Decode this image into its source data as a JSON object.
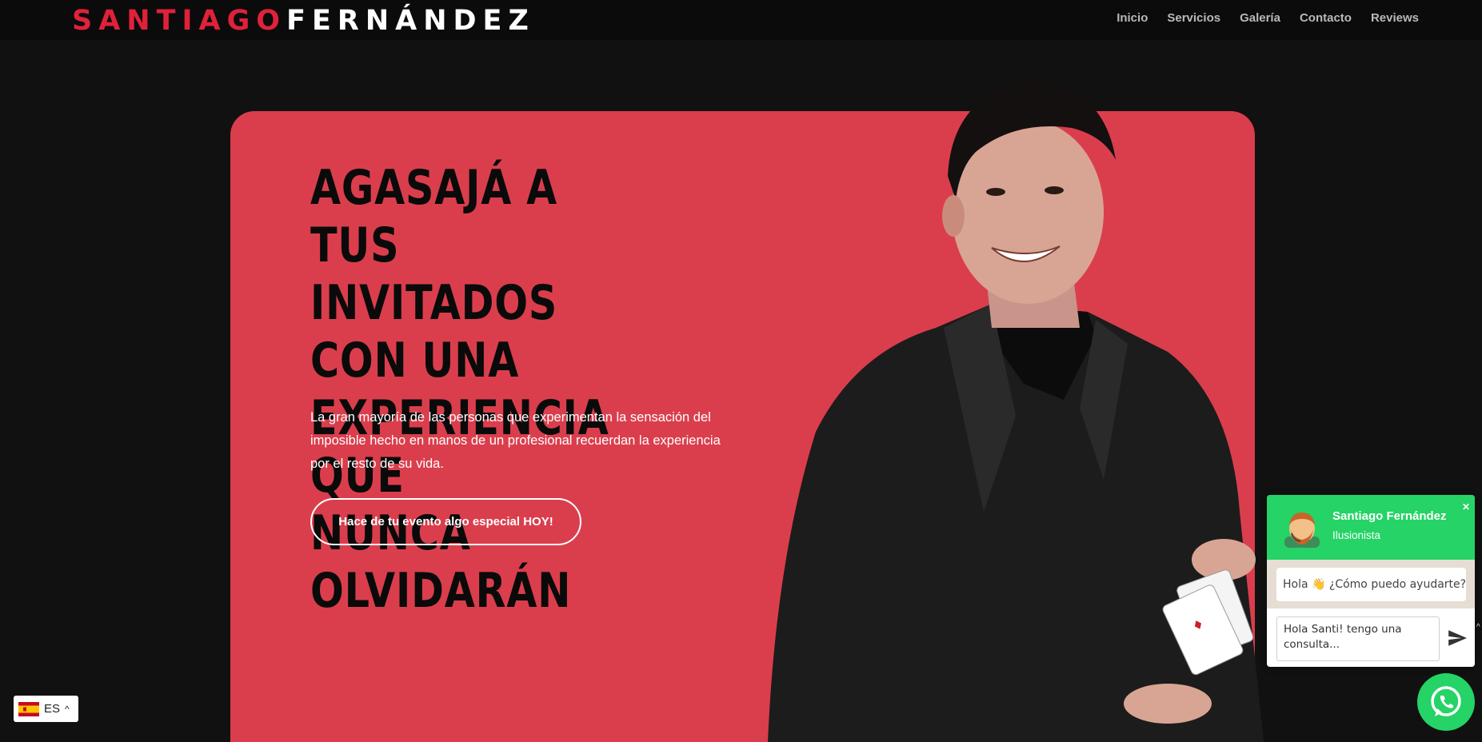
{
  "brand": {
    "first": "SANTIAGO",
    "last": "FERNÁNDEZ",
    "accent_color": "#e0213a"
  },
  "nav": {
    "items": [
      {
        "label": "Inicio"
      },
      {
        "label": "Servicios"
      },
      {
        "label": "Galería"
      },
      {
        "label": "Contacto"
      },
      {
        "label": "Reviews"
      }
    ]
  },
  "hero": {
    "background": "#da3e4c",
    "headline_lines": [
      "AGASAJÁ A TUS",
      "INVITADOS CON UNA",
      "EXPERIENCIA QUE",
      "NUNCA OLVIDARÁN"
    ],
    "subtitle": "La gran mayoría de las personas que experimentan la sensación del imposible hecho en manos de un profesional recuerdan la experiencia por el resto de su vida.",
    "cta_label": "Hace de tu evento algo especial HOY!"
  },
  "language": {
    "code": "ES",
    "flag_icon": "spain-flag-icon",
    "chevron_icon": "chevron-up-icon"
  },
  "chat": {
    "name": "Santiago Fernández",
    "role": "Ilusionista",
    "greeting": "Hola 👋 ¿Cómo puedo ayudarte?",
    "input_value": "Hola Santi! tengo una consulta...",
    "header_color": "#25d366",
    "close_icon": "close-icon",
    "send_icon": "send-icon"
  },
  "whatsapp_icon": "whatsapp-icon"
}
